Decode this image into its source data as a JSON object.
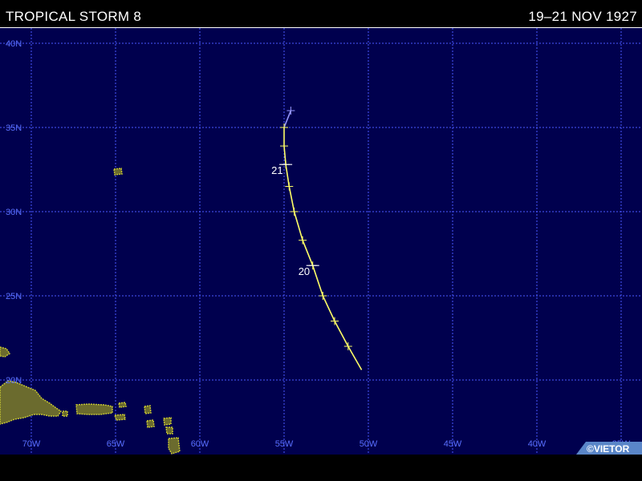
{
  "header": {
    "title": "TROPICAL STORM 8",
    "dates": "19–21 NOV 1927"
  },
  "credit": "©VIETOR",
  "map": {
    "lat_labels": [
      "40N",
      "35N",
      "30N",
      "25N",
      "20N"
    ],
    "lon_labels": [
      "70W",
      "65W",
      "60W",
      "55W",
      "50W",
      "45W",
      "40W",
      "35W"
    ],
    "track_points": [
      {
        "lon": -50.4,
        "lat": 20.6
      },
      {
        "lon": -51.2,
        "lat": 22.0
      },
      {
        "lon": -52.0,
        "lat": 23.5
      },
      {
        "lon": -52.7,
        "lat": 25.0
      },
      {
        "lon": -53.3,
        "lat": 26.8
      },
      {
        "lon": -53.9,
        "lat": 28.3
      },
      {
        "lon": -54.4,
        "lat": 30.0
      },
      {
        "lon": -54.7,
        "lat": 31.5
      },
      {
        "lon": -54.9,
        "lat": 32.8
      },
      {
        "lon": -55.0,
        "lat": 33.9
      },
      {
        "lon": -55.0,
        "lat": 35.0
      },
      {
        "lon": -54.6,
        "lat": 36.0
      }
    ],
    "day_markers": [
      {
        "label": "20",
        "lon": -53.3,
        "lat": 26.8
      },
      {
        "label": "21",
        "lon": -54.9,
        "lat": 32.8
      }
    ],
    "colors": {
      "ocean": "#00004e",
      "grid": "#4a58ff",
      "grid_label": "#5a70ff",
      "track_storm": "#ffff66",
      "track_extratropical": "#9999ff",
      "land": "#6b6b2e",
      "land_edge": "#c8c832",
      "day_label": "#ffffff"
    }
  }
}
